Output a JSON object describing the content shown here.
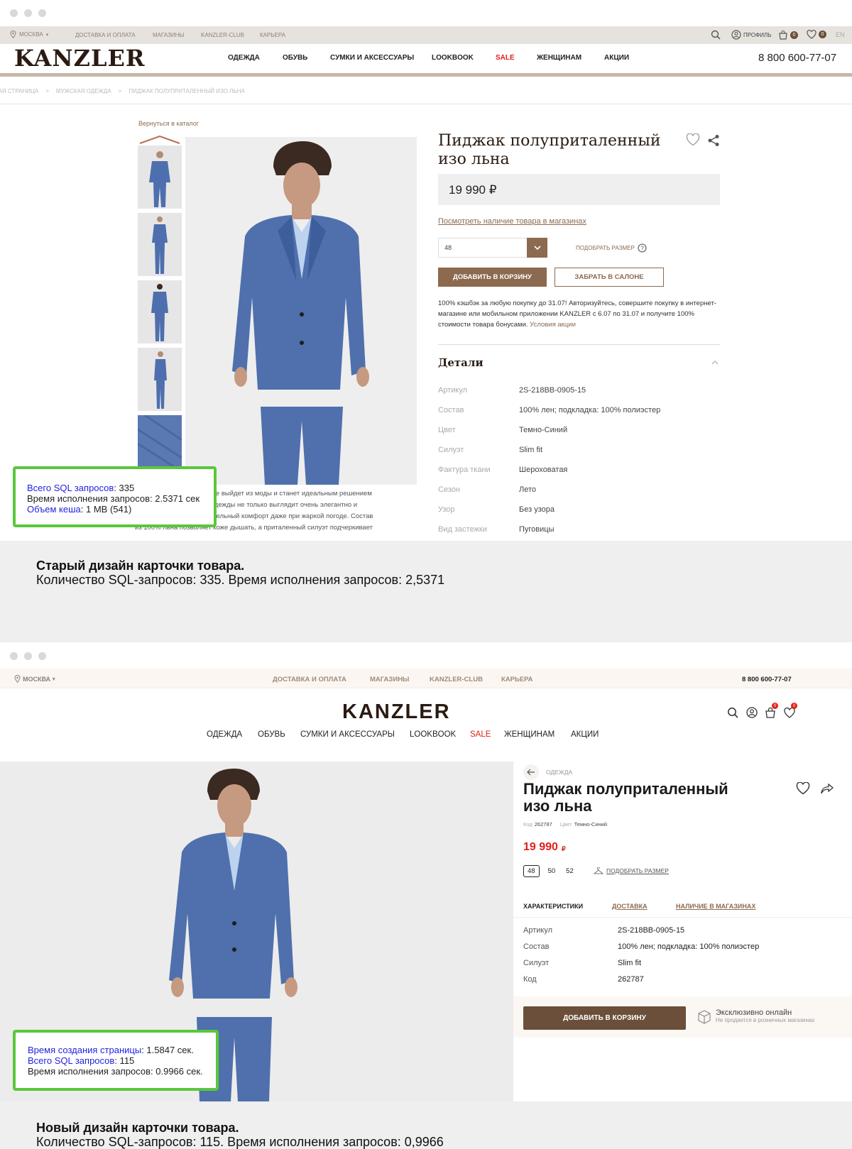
{
  "old": {
    "header": {
      "city": "МОСКВА",
      "top_links": [
        "ДОСТАВКА И ОПЛАТА",
        "МАГАЗИНЫ",
        "KANZLER-CLUB",
        "КАРЬЕРА"
      ],
      "profile": "ПРОФИЛЬ",
      "cart_count": "0",
      "fav_count": "0",
      "lang": "EN",
      "logo": "KANZLER",
      "nav": [
        "ОДЕЖДА",
        "ОБУВЬ",
        "СУМКИ И АКСЕССУАРЫ",
        "LOOKBOOK",
        "SALE",
        "ЖЕНЩИНАМ",
        "АКЦИИ"
      ],
      "phone": "8 800 600-77-07"
    },
    "breadcrumbs": [
      "ГЛАВНАЯ СТРАНИЦА",
      "МУЖСКАЯ ОДЕЖДА",
      "ПИДЖАК ПОЛУПРИТАЛЕННЫЙ ИЗО ЛЬНА"
    ],
    "back_link": "Вернуться в каталог",
    "product": {
      "title": "Пиджак полуприталенный изо льна",
      "price": "19 990 ₽",
      "availability": "Посмотреть наличие товара в магазинах",
      "size": "48",
      "size_help": "ПОДОБРАТЬ РАЗМЕР",
      "add_to_cart": "ДОБАВИТЬ В КОРЗИНУ",
      "pickup": "ЗАБРАТЬ В САЛОНЕ",
      "promo": "100% кэшбэк за любую покупку до 31.07! Авторизуйтесь, совершите покупку в интернет-магазине или мобильном приложении KANZLER с 6.07 по 31.07 и получите 100% стоимости товара бонусами.",
      "promo_link": "Условия акции",
      "details_title": "Детали",
      "details": [
        {
          "label": "Артикул",
          "value": "2S-218BB-0905-15"
        },
        {
          "label": "Состав",
          "value": "100% лен; подкладка: 100% полиэстер"
        },
        {
          "label": "Цвет",
          "value": "Темно-Синий"
        },
        {
          "label": "Силуэт",
          "value": "Slim fit"
        },
        {
          "label": "Фактура ткани",
          "value": "Шероховатая"
        },
        {
          "label": "Сезон",
          "value": "Лето"
        },
        {
          "label": "Узор",
          "value": "Без узора"
        },
        {
          "label": "Вид застежки",
          "value": "Пуговицы"
        }
      ],
      "description": [
        "Пиджак из льна никогда не выйдет из моды и станет идеальным решением",
        "для лета. Этот предмет одежды не только выглядит очень элегантно и",
        "стильно, но и дает удивительный комфорт даже при жаркой погоде. Состав",
        "из 100% льна позволяет коже дышать, а приталенный силуэт подчеркивает"
      ]
    },
    "debug": [
      {
        "key": "Всего SQL запросов",
        "value": ": 335",
        "highlight": true
      },
      {
        "key": "Время исполнения запросов",
        "value": ": 2.5371 сек",
        "highlight": false
      },
      {
        "key": "Объем кеша",
        "value": ": 1 MB (541)",
        "highlight": true
      }
    ],
    "caption_title": "Старый дизайн карточки товара.",
    "caption_text": "Количество SQL-запросов: 335. Время исполнения запросов: 2,5371"
  },
  "new": {
    "header": {
      "city": "МОСКВА",
      "top_links": [
        "ДОСТАВКА И ОПЛАТА",
        "МАГАЗИНЫ",
        "KANZLER-CLUB",
        "КАРЬЕРА"
      ],
      "phone": "8 800 600-77-07",
      "logo": "KANZLER",
      "cart_count": "0",
      "fav_count": "0",
      "nav": [
        "ОДЕЖДА",
        "ОБУВЬ",
        "СУМКИ И АКСЕССУАРЫ",
        "LOOKBOOK",
        "SALE",
        "ЖЕНЩИНАМ",
        "АКЦИИ"
      ]
    },
    "product": {
      "crumb": "ОДЕЖДА",
      "title_line1": "Пиджак полуприталенный",
      "title_line2": "изо льна",
      "code_label": "Код",
      "code": "262787",
      "color_label": "Цвет",
      "color": "Темно-Синий",
      "price": "19 990",
      "currency": "₽",
      "sizes": [
        "48",
        "50",
        "52"
      ],
      "size_help": "ПОДОБРАТЬ РАЗМЕР",
      "tabs": [
        "ХАРАКТЕРИСТИКИ",
        "ДОСТАВКА",
        "НАЛИЧИЕ В МАГАЗИНАХ"
      ],
      "specs": [
        {
          "label": "Артикул",
          "value": "2S-218BB-0905-15"
        },
        {
          "label": "Состав",
          "value": "100% лен; подкладка: 100% полиэстер"
        },
        {
          "label": "Силуэт",
          "value": "Slim fit"
        },
        {
          "label": "Код",
          "value": "262787"
        }
      ],
      "add_to_cart": "ДОБАВИТЬ В КОРЗИНУ",
      "exclusive_title": "Эксклюзивно онлайн",
      "exclusive_sub": "Не продается в розничных магазинах"
    },
    "debug": [
      {
        "key": "Время создания страницы",
        "value": ": 1.5847 сек.",
        "highlight": true
      },
      {
        "key": "Всего SQL запросов",
        "value": ": 115",
        "highlight": true
      },
      {
        "key": "Время исполнения запросов",
        "value": ": 0.9966 сек.",
        "highlight": false
      }
    ],
    "caption_title": "Новый дизайн карточки товара.",
    "caption_text": "Количество SQL-запросов: 115. Время исполнения запросов: 0,9966"
  },
  "colors": {
    "accent": "#8b6a4f",
    "button": "#6b4f3a",
    "sale": "#e0201b",
    "debug_border": "#5ac73b",
    "debug_key": "#2323e0"
  }
}
